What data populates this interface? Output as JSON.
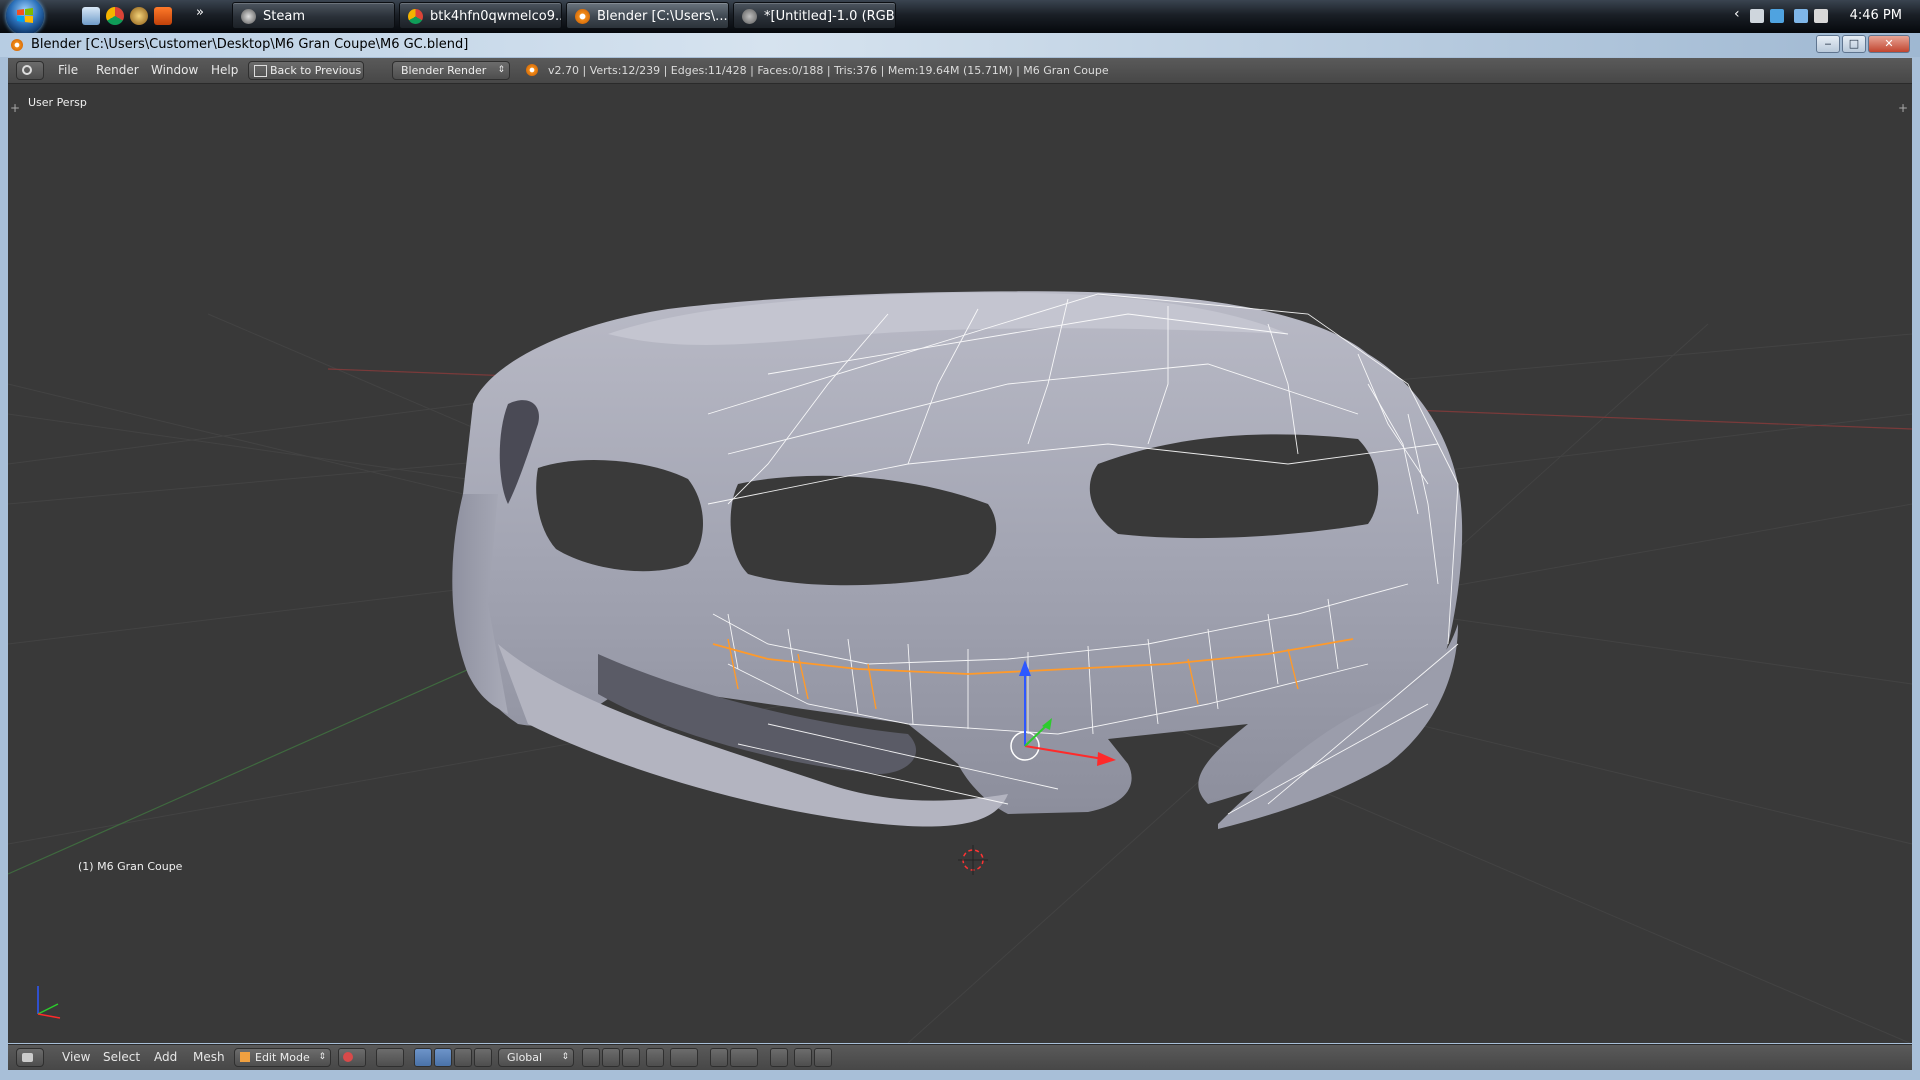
{
  "taskbar": {
    "quick_launch": [
      "show-desktop-icon",
      "chrome-icon",
      "wow-icon",
      "kongregate-icon"
    ],
    "more_glyph": "»",
    "tasks": [
      {
        "label": "Steam",
        "icon": "steam-icon"
      },
      {
        "label": "btk4hfn0qwmelco9...",
        "icon": "chrome-icon"
      },
      {
        "label": "Blender [C:\\Users\\...",
        "icon": "blender-icon"
      },
      {
        "label": "*[Untitled]-1.0 (RGB...",
        "icon": "gimp-icon"
      }
    ],
    "tray_expand": "‹",
    "clock": "4:46 PM"
  },
  "window": {
    "title": "Blender [C:\\Users\\Customer\\Desktop\\M6 Gran Coupe\\M6 GC.blend]",
    "controls": {
      "minimize": "‒",
      "maximize": "□",
      "close": "✕"
    }
  },
  "info_header": {
    "menus": [
      "File",
      "Render",
      "Window",
      "Help"
    ],
    "back_button": "Back to Previous",
    "render_engine": "Blender Render",
    "stats": "v2.70 | Verts:12/239 | Edges:11/428 | Faces:0/188 | Tris:376 | Mem:19.64M (15.71M) | M6 Gran Coupe"
  },
  "viewport": {
    "view_name": "User Persp",
    "object_label": "(1) M6 Gran Coupe",
    "colors": {
      "background": "#393939",
      "mesh": "#a7a9b5",
      "wire": "#ffffff",
      "selected_edge": "#ff9a2a"
    }
  },
  "view3d_header": {
    "menus": [
      "View",
      "Select",
      "Add",
      "Mesh"
    ],
    "mode": "Edit Mode",
    "orientation": "Global"
  }
}
